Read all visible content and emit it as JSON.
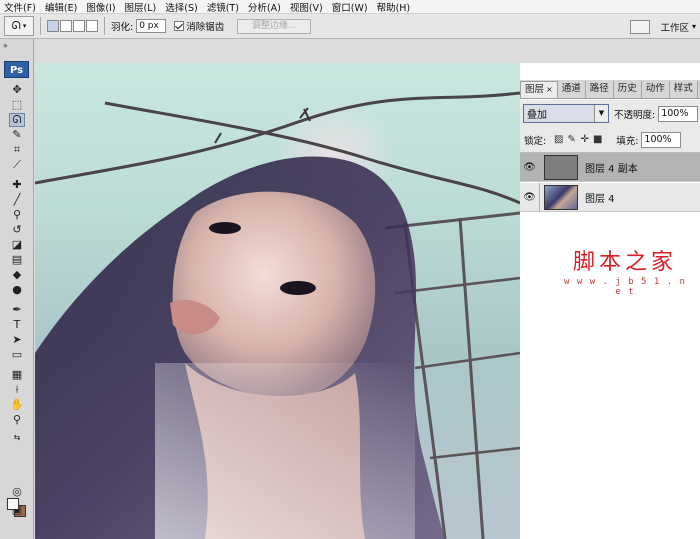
{
  "menu": [
    "文件(F)",
    "编辑(E)",
    "图像(I)",
    "图层(L)",
    "选择(S)",
    "滤镜(T)",
    "分析(A)",
    "视图(V)",
    "窗口(W)",
    "帮助(H)"
  ],
  "options": {
    "feather_label": "羽化:",
    "feather_value": "0 px",
    "antialias_label": "消除锯齿",
    "refine_edge_label": "调整边缘...",
    "workspace_label": "工作区"
  },
  "toolbox": {
    "collapse": "»",
    "logo": "Ps",
    "tools": [
      "move-tool",
      "marquee-tool",
      "lasso-tool",
      "quick-selection-tool",
      "crop-tool",
      "slice-tool",
      "healing-brush-tool",
      "brush-tool",
      "clone-stamp-tool",
      "history-brush-tool",
      "eraser-tool",
      "gradient-tool",
      "blur-tool",
      "dodge-tool",
      "pen-tool",
      "type-tool",
      "path-selection-tool",
      "shape-tool",
      "notes-tool",
      "eyedropper-tool",
      "hand-tool",
      "zoom-tool"
    ],
    "foreground_color": "#f6f6f6",
    "background_color": "#9c6c48"
  },
  "layers_panel": {
    "tabs": [
      "图层",
      "通道",
      "路径",
      "历史",
      "动作",
      "样式"
    ],
    "tab_close": "×",
    "blend_mode": "叠加",
    "opacity_label": "不透明度:",
    "opacity_value": "100%",
    "lock_label": "锁定:",
    "fill_label": "填充:",
    "fill_value": "100%",
    "layers": [
      {
        "name": "图层 4 副本",
        "visible": true,
        "selected": true
      },
      {
        "name": "图层 4",
        "visible": true,
        "selected": false
      }
    ]
  },
  "watermark": {
    "title": "脚本之家",
    "url": "w w w . j b 5 1 . n e t"
  }
}
